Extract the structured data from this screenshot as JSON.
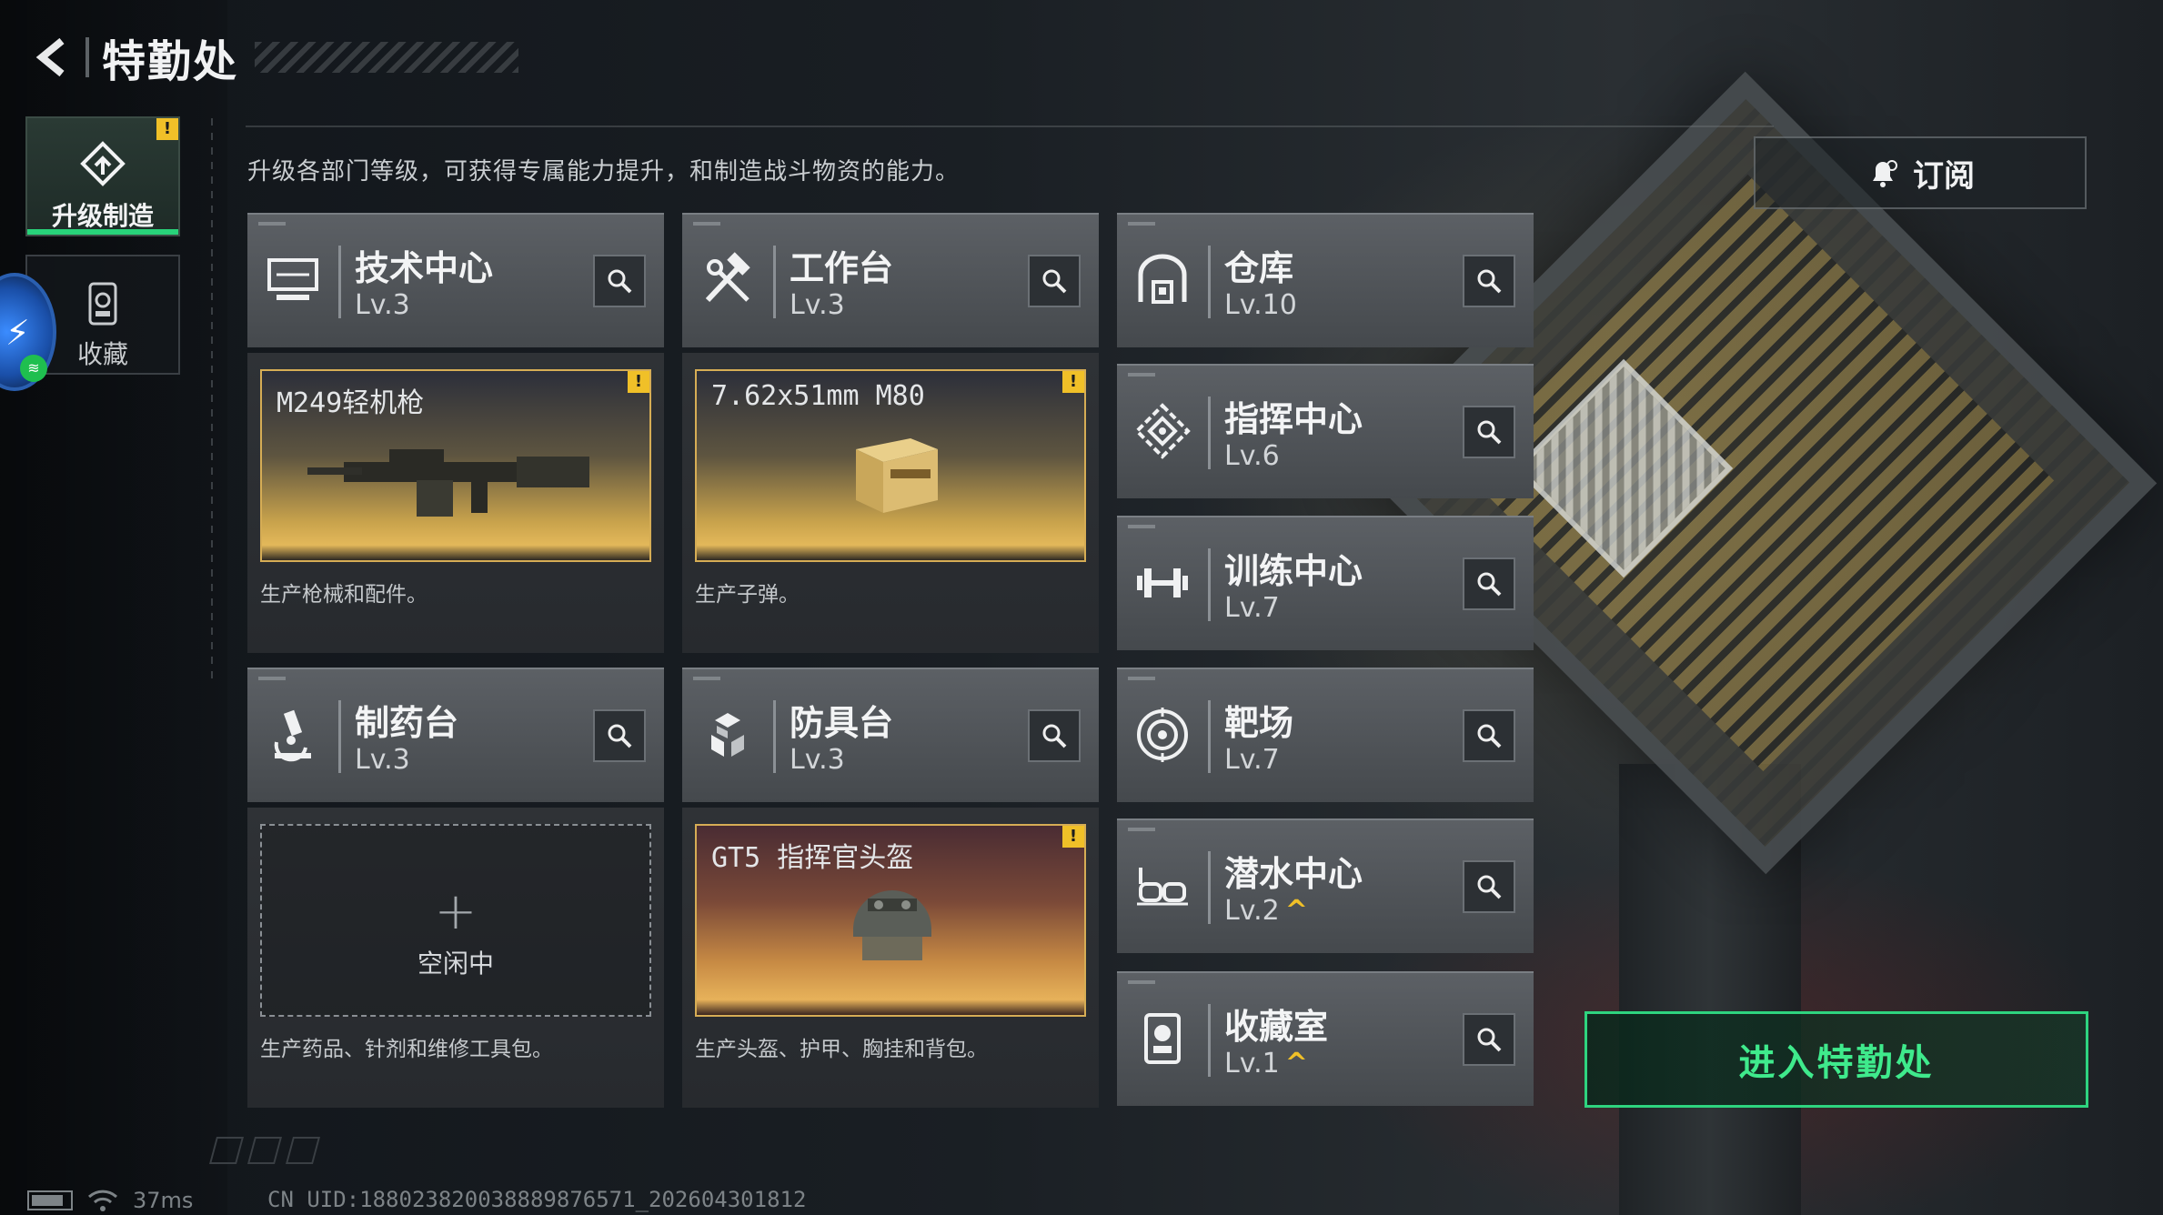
{
  "header": {
    "title": "特勤处"
  },
  "tabs": [
    {
      "label": "升级制造",
      "icon": "upgrade-icon",
      "alert": "!"
    },
    {
      "label": "收藏",
      "icon": "collection-icon"
    }
  ],
  "intro": "升级各部门等级，可获得专属能力提升，和制造战斗物资的能力。",
  "subscribe": {
    "label": "订阅",
    "icon": "bell-icon"
  },
  "departments": [
    {
      "name": "技术中心",
      "level": "Lv.3",
      "icon": "computer-icon"
    },
    {
      "name": "工作台",
      "level": "Lv.3",
      "icon": "hammer-wrench-icon"
    },
    {
      "name": "仓库",
      "level": "Lv.10",
      "icon": "warehouse-icon"
    },
    {
      "name": "指挥中心",
      "level": "Lv.6",
      "icon": "command-icon"
    },
    {
      "name": "训练中心",
      "level": "Lv.7",
      "icon": "dumbbell-icon"
    },
    {
      "name": "制药台",
      "level": "Lv.3",
      "icon": "microscope-icon"
    },
    {
      "name": "防具台",
      "level": "Lv.3",
      "icon": "armor-icon"
    },
    {
      "name": "靶场",
      "level": "Lv.7",
      "icon": "target-icon"
    },
    {
      "name": "潜水中心",
      "level": "Lv.2",
      "upgradable": "^",
      "icon": "diving-mask-icon"
    },
    {
      "name": "收藏室",
      "level": "Lv.1",
      "upgradable": "^",
      "icon": "collection-room-icon"
    }
  ],
  "production": [
    {
      "item": "M249轻机枪",
      "desc": "生产枪械和配件。",
      "alert": "!"
    },
    {
      "item": "7.62x51mm M80",
      "desc": "生产子弹。",
      "alert": "!"
    },
    {
      "item": "",
      "idle": "空闲中",
      "plus": "+",
      "desc": "生产药品、针剂和维修工具包。"
    },
    {
      "item": "GT5 指挥官头盔",
      "desc": "生产头盔、护甲、胸挂和背包。",
      "alert": "!"
    }
  ],
  "enter_button": "进入特勤处",
  "status": {
    "ping": "37ms",
    "uid": "CN UID:18802382003888987657­1_202604301812"
  },
  "colors": {
    "accent_green": "#2ed47f",
    "alert_yellow": "#f0c028"
  }
}
